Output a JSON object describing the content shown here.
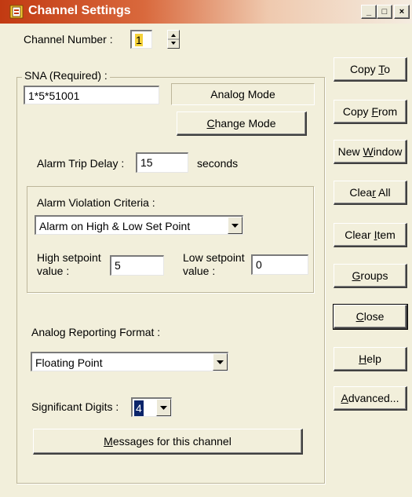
{
  "window": {
    "title": "Channel Settings",
    "controls": {
      "minimize": "_",
      "maximize": "□",
      "close": "×"
    }
  },
  "channel": {
    "label": "Channel Number :",
    "value": "1"
  },
  "sna": {
    "group_label": "SNA (Required) :",
    "value": "1*5*51001",
    "mode_text": "Analog Mode",
    "change_mode_pre": "",
    "change_mode_acc": "C",
    "change_mode_post": "hange Mode"
  },
  "alarm_trip": {
    "label": "Alarm Trip Delay :",
    "value": "15",
    "unit": "seconds"
  },
  "violation": {
    "group_label": "Alarm Violation Criteria :",
    "selected": "Alarm on High & Low Set Point",
    "high_label_1": "High setpoint",
    "high_label_2": "value :",
    "high_value": "5",
    "low_label_1": "Low setpoint",
    "low_label_2": "value :",
    "low_value": "0"
  },
  "reporting": {
    "label": "Analog Reporting Format :",
    "selected": "Floating Point"
  },
  "digits": {
    "label": "Significant Digits :",
    "selected": "4"
  },
  "messages_button": {
    "pre": "",
    "acc": "M",
    "post": "essages for this channel"
  },
  "side_buttons": [
    {
      "pre": "Copy ",
      "acc": "T",
      "post": "o"
    },
    {
      "pre": "Copy ",
      "acc": "F",
      "post": "rom"
    },
    {
      "pre": "New ",
      "acc": "W",
      "post": "indow"
    },
    {
      "pre": "Clea",
      "acc": "r",
      "post": " All"
    },
    {
      "pre": "Clear ",
      "acc": "I",
      "post": "tem"
    },
    {
      "pre": "",
      "acc": "G",
      "post": "roups"
    },
    {
      "pre": "",
      "acc": "C",
      "post": "lose"
    },
    {
      "pre": "",
      "acc": "H",
      "post": "elp"
    },
    {
      "pre": "",
      "acc": "A",
      "post": "dvanced..."
    }
  ],
  "colors": {
    "dialog_bg": "#f2efdb",
    "title_start": "#c23a12",
    "selection": "#0a246a"
  }
}
